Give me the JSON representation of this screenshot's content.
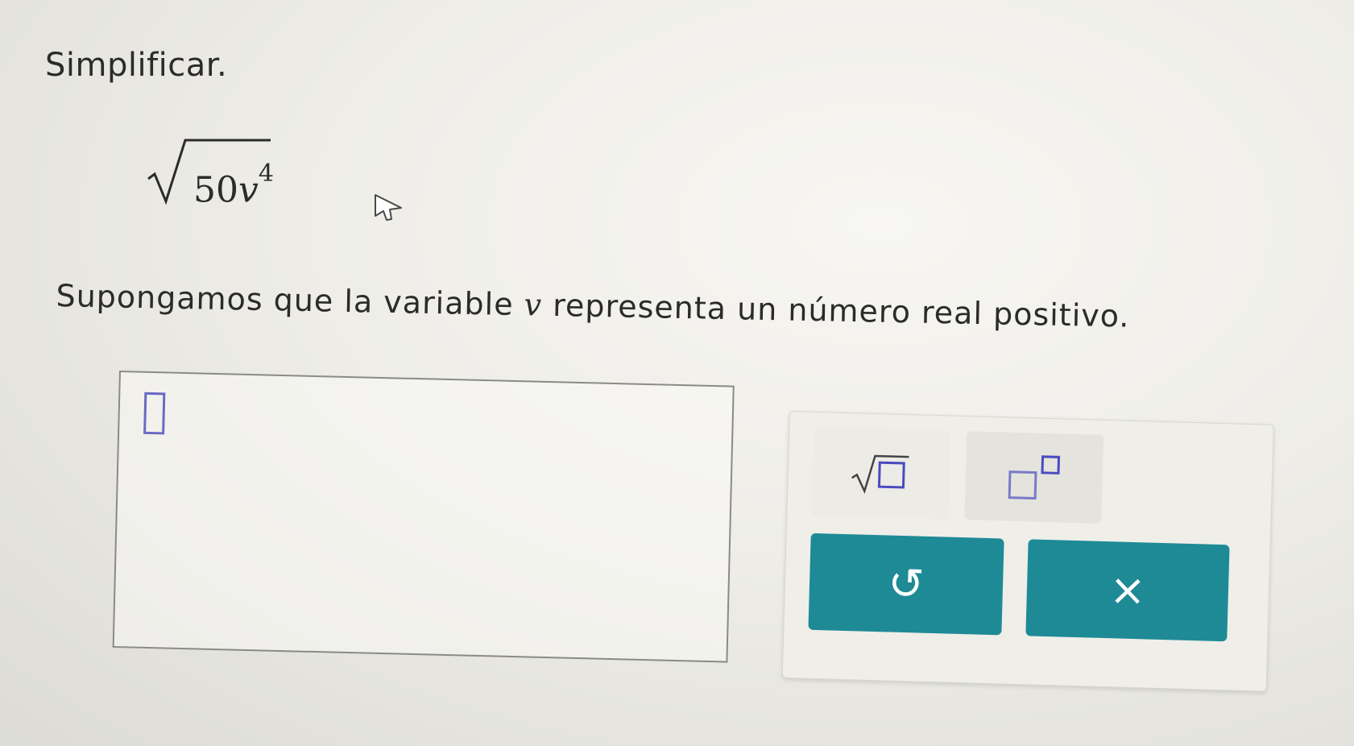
{
  "prompt": "Simplificar.",
  "expression": {
    "coefficient": "50",
    "variable": "v",
    "exponent": "4"
  },
  "assumption": {
    "before": "Supongamos que la variable ",
    "variable": "v",
    "after": " representa un número real positivo."
  },
  "answer": {
    "value": ""
  },
  "keypad": {
    "keys": [
      {
        "id": "sqrt",
        "icon": "square-root-template-icon"
      },
      {
        "id": "exponent",
        "icon": "exponent-template-icon"
      },
      {
        "id": "undo",
        "icon": "undo-icon",
        "label": "↺"
      },
      {
        "id": "clear",
        "icon": "clear-icon",
        "label": "×"
      }
    ],
    "action_color": "#1e8a96",
    "placeholder_box_color": "#6a6ac4"
  }
}
